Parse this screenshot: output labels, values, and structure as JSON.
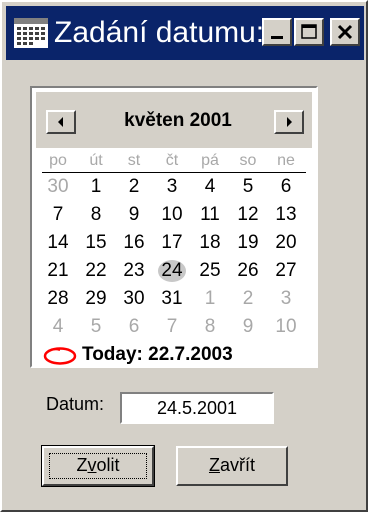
{
  "window": {
    "title": "Zadání datumu:",
    "icon": "calendar-grid-icon"
  },
  "titlebar_buttons": [
    {
      "name": "minimize",
      "icon": "minimize-icon"
    },
    {
      "name": "maximize",
      "icon": "maximize-icon"
    },
    {
      "name": "close",
      "icon": "close-icon"
    }
  ],
  "calendar": {
    "month_label": "květen 2001",
    "prev_icon": "arrow-left-icon",
    "next_icon": "arrow-right-icon",
    "weekdays": [
      "po",
      "út",
      "st",
      "čt",
      "pá",
      "so",
      "ne"
    ],
    "weeks": [
      [
        {
          "d": "30",
          "o": true
        },
        {
          "d": "1"
        },
        {
          "d": "2"
        },
        {
          "d": "3"
        },
        {
          "d": "4"
        },
        {
          "d": "5"
        },
        {
          "d": "6"
        }
      ],
      [
        {
          "d": "7"
        },
        {
          "d": "8"
        },
        {
          "d": "9"
        },
        {
          "d": "10"
        },
        {
          "d": "11"
        },
        {
          "d": "12"
        },
        {
          "d": "13"
        }
      ],
      [
        {
          "d": "14"
        },
        {
          "d": "15"
        },
        {
          "d": "16"
        },
        {
          "d": "17"
        },
        {
          "d": "18"
        },
        {
          "d": "19"
        },
        {
          "d": "20"
        }
      ],
      [
        {
          "d": "21"
        },
        {
          "d": "22"
        },
        {
          "d": "23"
        },
        {
          "d": "24",
          "sel": true
        },
        {
          "d": "25"
        },
        {
          "d": "26"
        },
        {
          "d": "27"
        }
      ],
      [
        {
          "d": "28"
        },
        {
          "d": "29"
        },
        {
          "d": "30"
        },
        {
          "d": "31"
        },
        {
          "d": "1",
          "o": true
        },
        {
          "d": "2",
          "o": true
        },
        {
          "d": "3",
          "o": true
        }
      ],
      [
        {
          "d": "4",
          "o": true
        },
        {
          "d": "5",
          "o": true
        },
        {
          "d": "6",
          "o": true
        },
        {
          "d": "7",
          "o": true
        },
        {
          "d": "8",
          "o": true
        },
        {
          "d": "9",
          "o": true
        },
        {
          "d": "10",
          "o": true
        }
      ]
    ],
    "today_label": "Today: 22.7.2003",
    "today_marker_color": "#ff0000"
  },
  "datum": {
    "label": "Datum:",
    "value": "24.5.2001"
  },
  "buttons": {
    "choose_prefix": "Z",
    "choose_underlined": "v",
    "choose_suffix": "olit",
    "close_prefix": "",
    "close_underlined": "Z",
    "close_suffix": "avřít"
  },
  "colors": {
    "titlebar": "#0a246a",
    "face": "#d4d0c8",
    "other_month": "#a8a8a8",
    "selected_bg": "#c8c8c8"
  }
}
